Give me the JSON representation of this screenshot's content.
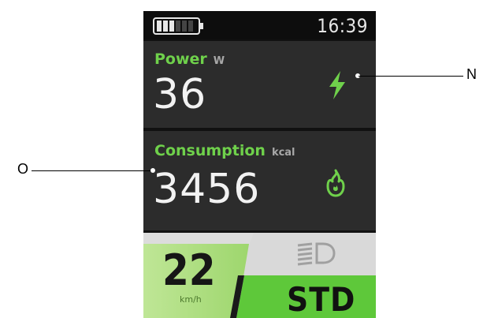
{
  "status_bar": {
    "battery_level": 0.4,
    "battery_icon": "battery-icon",
    "time": "16:39"
  },
  "power": {
    "title": "Power",
    "unit": "W",
    "value": "36",
    "icon": "lightning-bolt-icon",
    "icon_color": "#6fd14b"
  },
  "consumption": {
    "title": "Consumption",
    "unit": "kcal",
    "value": "3456",
    "icon": "flame-icon",
    "icon_color": "#6fd14b"
  },
  "speed": {
    "value": "22",
    "unit": "km/h",
    "panel_color": "#b4e08a"
  },
  "headlight": {
    "icon": "headlight-icon",
    "state": "off"
  },
  "mode": {
    "label": "STD",
    "color": "#5ec83a"
  },
  "callouts": {
    "power_icon": "N",
    "consumption_card": "O"
  },
  "colors": {
    "accent": "#6fd14b",
    "card_background": "#2c2c2c",
    "screen_background": "#111111"
  }
}
